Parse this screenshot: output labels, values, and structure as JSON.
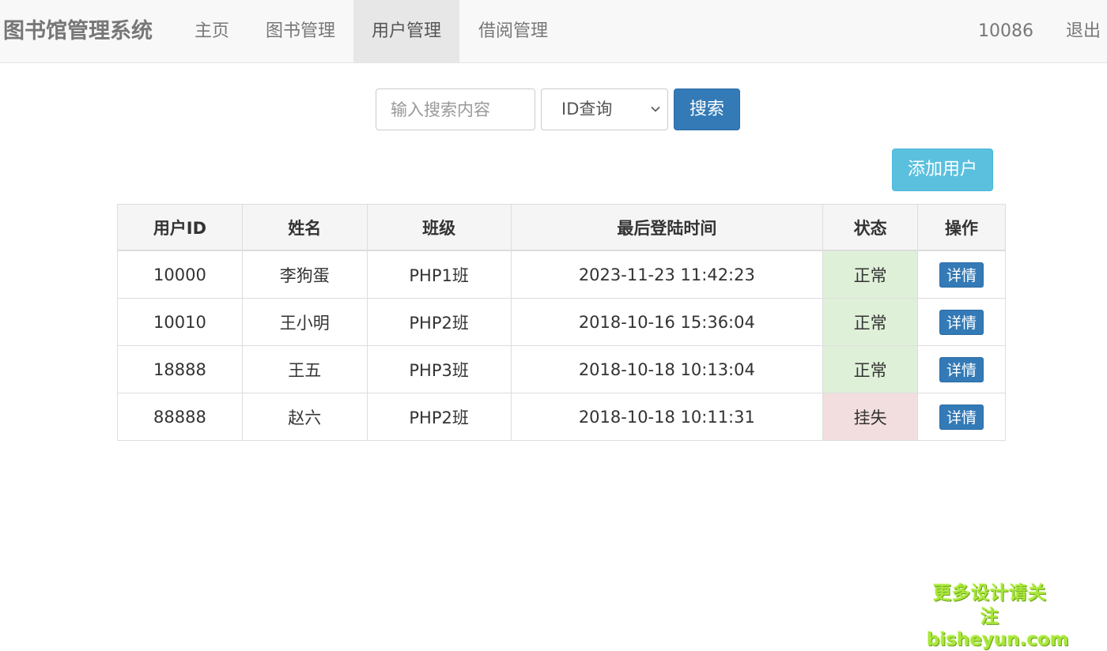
{
  "navbar": {
    "brand": "图书馆管理系统",
    "items": [
      {
        "label": "主页",
        "active": false
      },
      {
        "label": "图书管理",
        "active": false
      },
      {
        "label": "用户管理",
        "active": true
      },
      {
        "label": "借阅管理",
        "active": false
      }
    ],
    "user_id": "10086",
    "logout": "退出"
  },
  "search": {
    "placeholder": "输入搜索内容",
    "value": "",
    "select_value": "ID查询",
    "button_label": "搜索"
  },
  "actions": {
    "add_user_label": "添加用户"
  },
  "table": {
    "headers": [
      "用户ID",
      "姓名",
      "班级",
      "最后登陆时间",
      "状态",
      "操作"
    ],
    "rows": [
      {
        "id": "10000",
        "name": "李狗蛋",
        "class": "PHP1班",
        "last_login": "2023-11-23 11:42:23",
        "status": "正常",
        "action": "详情"
      },
      {
        "id": "10010",
        "name": "王小明",
        "class": "PHP2班",
        "last_login": "2018-10-16 15:36:04",
        "status": "正常",
        "action": "详情"
      },
      {
        "id": "18888",
        "name": "王五",
        "class": "PHP3班",
        "last_login": "2018-10-18 10:13:04",
        "status": "正常",
        "action": "详情"
      },
      {
        "id": "88888",
        "name": "赵六",
        "class": "PHP2班",
        "last_login": "2018-10-18 10:11:31",
        "status": "挂失",
        "action": "详情"
      }
    ]
  },
  "watermark": {
    "line1": "更多设计请关注",
    "line2": "bisheyun.com"
  },
  "colors": {
    "primary": "#337ab7",
    "info": "#5bc0de",
    "success_bg": "#dff0d8",
    "danger_bg": "#f2dede",
    "watermark": "#a8e63a"
  }
}
